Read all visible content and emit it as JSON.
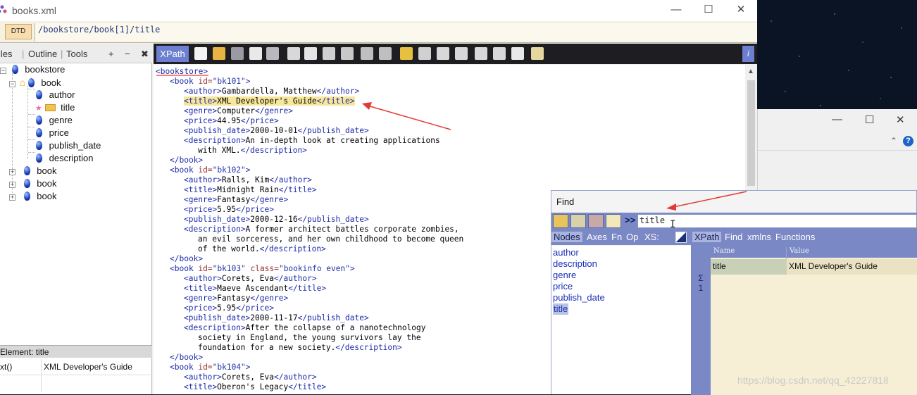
{
  "window": {
    "title": "books.xml",
    "controls": [
      "—",
      "☐",
      "✕"
    ]
  },
  "xpath_bar": {
    "dtd_label": "DTD",
    "path": "/bookstore/book[1]/title"
  },
  "left_panel": {
    "tabs": [
      "iles",
      "Outline",
      "Tools"
    ],
    "actions": [
      "+",
      "−",
      "✖"
    ],
    "tree": [
      {
        "label": "bookstore",
        "icon": "bulb-icon"
      },
      {
        "label": "book",
        "icon": "bulb-icon"
      },
      {
        "label": "author",
        "icon": "bulb-icon"
      },
      {
        "label": "title",
        "icon": "folder-icon"
      },
      {
        "label": "genre",
        "icon": "bulb-icon"
      },
      {
        "label": "price",
        "icon": "bulb-icon"
      },
      {
        "label": "publish_date",
        "icon": "bulb-icon"
      },
      {
        "label": "description",
        "icon": "bulb-icon"
      },
      {
        "label": "book",
        "icon": "bulb-icon"
      },
      {
        "label": "book",
        "icon": "bulb-icon"
      },
      {
        "label": "book",
        "icon": "bulb-icon"
      }
    ],
    "element_header": "Element: title",
    "element_row": {
      "name": "xt()",
      "value": "XML Developer's Guide"
    }
  },
  "toolbar": {
    "xpath_tab": "XPath",
    "info_label": "i"
  },
  "editor": {
    "lines": [
      {
        "tag": "<bookstore>"
      },
      {
        "open": "<book ",
        "attr": "id=",
        "val": "\"bk101\"",
        "close": ">"
      },
      {
        "open": "<author>",
        "text": "Gambardella, Matthew",
        "end": "</author>"
      },
      {
        "open": "<title>",
        "text": "XML Developer's Guide",
        "end": "</title>"
      },
      {
        "open": "<genre>",
        "text": "Computer",
        "end": "</genre>"
      },
      {
        "open": "<price>",
        "text": "44.95",
        "end": "</price>"
      },
      {
        "open": "<publish_date>",
        "text": "2000-10-01",
        "end": "</publish_date>"
      },
      {
        "open": "<description>",
        "text": "An in-depth look at creating applications",
        "end": ""
      },
      {
        "text": "with XML.",
        "end": "</description>"
      },
      {
        "tag": "</book>"
      },
      {
        "open": "<book ",
        "attr": "id=",
        "val": "\"bk102\"",
        "close": ">"
      },
      {
        "open": "<author>",
        "text": "Ralls, Kim",
        "end": "</author>"
      },
      {
        "open": "<title>",
        "text": "Midnight Rain",
        "end": "</title>"
      },
      {
        "open": "<genre>",
        "text": "Fantasy",
        "end": "</genre>"
      },
      {
        "open": "<price>",
        "text": "5.95",
        "end": "</price>"
      },
      {
        "open": "<publish_date>",
        "text": "2000-12-16",
        "end": "</publish_date>"
      },
      {
        "open": "<description>",
        "text": "A former architect battles corporate zombies,",
        "end": ""
      },
      {
        "text": "an evil sorceress, and her own childhood to become queen",
        "end": ""
      },
      {
        "text": "of the world.",
        "end": "</description>"
      },
      {
        "tag": "</book>"
      },
      {
        "open": "<book ",
        "attr": "id=",
        "val": "\"bk103\"",
        "attr2": " class=",
        "val2": "\"bookinfo even\"",
        "close": ">"
      },
      {
        "open": "<author>",
        "text": "Corets, Eva",
        "end": "</author>"
      },
      {
        "open": "<title>",
        "text": "Maeve Ascendant",
        "end": "</title>"
      },
      {
        "open": "<genre>",
        "text": "Fantasy",
        "end": "</genre>"
      },
      {
        "open": "<price>",
        "text": "5.95",
        "end": "</price>"
      },
      {
        "open": "<publish_date>",
        "text": "2000-11-17",
        "end": "</publish_date>"
      },
      {
        "open": "<description>",
        "text": "After the collapse of a nanotechnology",
        "end": ""
      },
      {
        "text": "society in England, the young survivors lay the",
        "end": ""
      },
      {
        "text": "foundation for a new society.",
        "end": "</description>"
      },
      {
        "tag": "</book>"
      },
      {
        "open": "<book ",
        "attr": "id=",
        "val": "\"bk104\"",
        "close": ">"
      },
      {
        "open": "<author>",
        "text": "Corets, Eva",
        "end": "</author>"
      },
      {
        "open": "<title>",
        "text": "Oberon's Legacy",
        "end": "</title>"
      }
    ]
  },
  "find_dialog": {
    "title": "Find",
    "chevron": ">>",
    "query": "title",
    "left_tabs": [
      "Nodes",
      "Axes",
      "Fn",
      "Op",
      "XS:"
    ],
    "nodes": [
      "author",
      "description",
      "genre",
      "price",
      "publish_date",
      "title"
    ],
    "right_tabs": [
      "XPath",
      "Find",
      "xmlns",
      "Functions"
    ],
    "sigma": "Σ",
    "count": "1",
    "grid_headers": [
      "Name",
      "Value"
    ],
    "result": {
      "name": "title",
      "value": "XML Developer's Guide"
    }
  },
  "watermark": "https://blog.csdn.net/qq_42227818",
  "colors": {
    "toolbar_bg": "#1e1e22",
    "accent_tab": "#6d7fd0",
    "find_panel": "#7a88c6",
    "annotation_arrow": "#e53935",
    "highlight": "#f7e79a"
  }
}
